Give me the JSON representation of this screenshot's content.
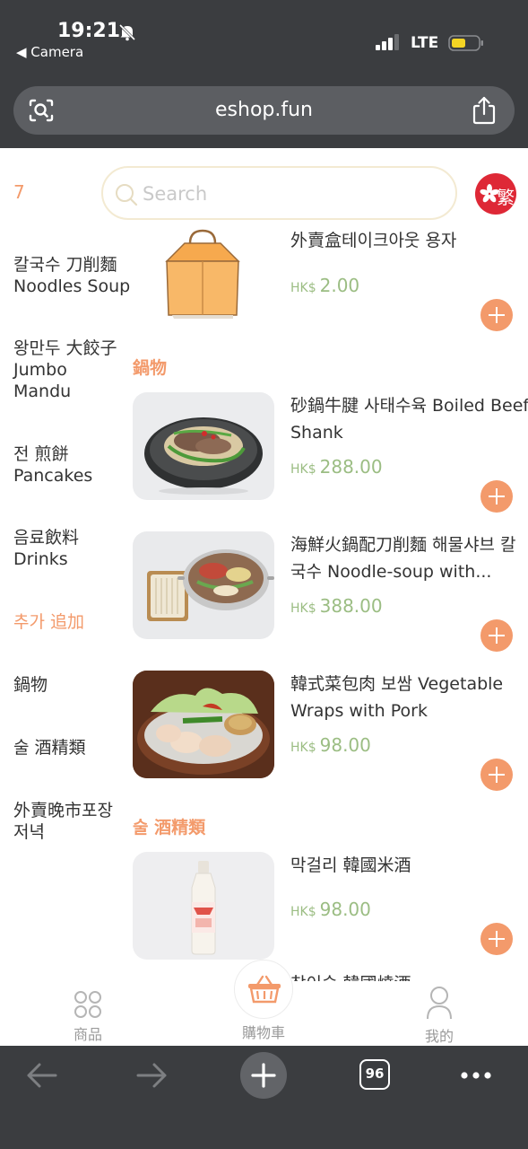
{
  "status_bar": {
    "time": "19:21",
    "back_app": "◀ Camera",
    "network": "LTE"
  },
  "browser": {
    "url": "eshop.fun",
    "tabs_count": "96"
  },
  "header": {
    "count": "7",
    "search_placeholder": "Search",
    "language": "繁"
  },
  "sidebar": {
    "items": [
      {
        "label_line1": "칼국수 刀削麵",
        "label_line2": "Noodles Soup"
      },
      {
        "label_line1": "왕만두 大餃子",
        "label_line2": "Jumbo",
        "label_line3": "Mandu"
      },
      {
        "label_line1": "전 煎餅",
        "label_line2": "Pancakes"
      },
      {
        "label_line1": "음료飲料",
        "label_line2": "Drinks"
      },
      {
        "label_line1": "추가 追加"
      },
      {
        "label_line1": "鍋物"
      },
      {
        "label_line1": "술 酒精類"
      },
      {
        "label_line1": "外賣晚市포장",
        "label_line2": "저녁"
      }
    ]
  },
  "sections": [
    {
      "title": "鍋物"
    },
    {
      "title": "술 酒精類"
    }
  ],
  "products": [
    {
      "name": "外賣盒테이크아웃 용자",
      "currency": "HK$",
      "price": "2.00"
    },
    {
      "name": "砂鍋牛腱 사태수육 Boiled Beef Shank",
      "currency": "HK$",
      "price": "288.00"
    },
    {
      "name": "海鮮火鍋配刀削麵 해물샤브 칼국수 Noodle-soup with...",
      "currency": "HK$",
      "price": "388.00"
    },
    {
      "name": "韓式菜包肉 보쌈 Vegetable Wraps with Pork",
      "currency": "HK$",
      "price": "98.00"
    },
    {
      "name": "막걸리 韓國米酒",
      "currency": "HK$",
      "price": "98.00"
    },
    {
      "name": "참이슬 韓國燒酒"
    }
  ],
  "tabbar": {
    "products_label": "商品",
    "cart_label": "購物車",
    "me_label": "我的"
  },
  "colors": {
    "accent": "#f39a6b",
    "price": "#9bbd83",
    "chrome": "#3b3d40"
  }
}
